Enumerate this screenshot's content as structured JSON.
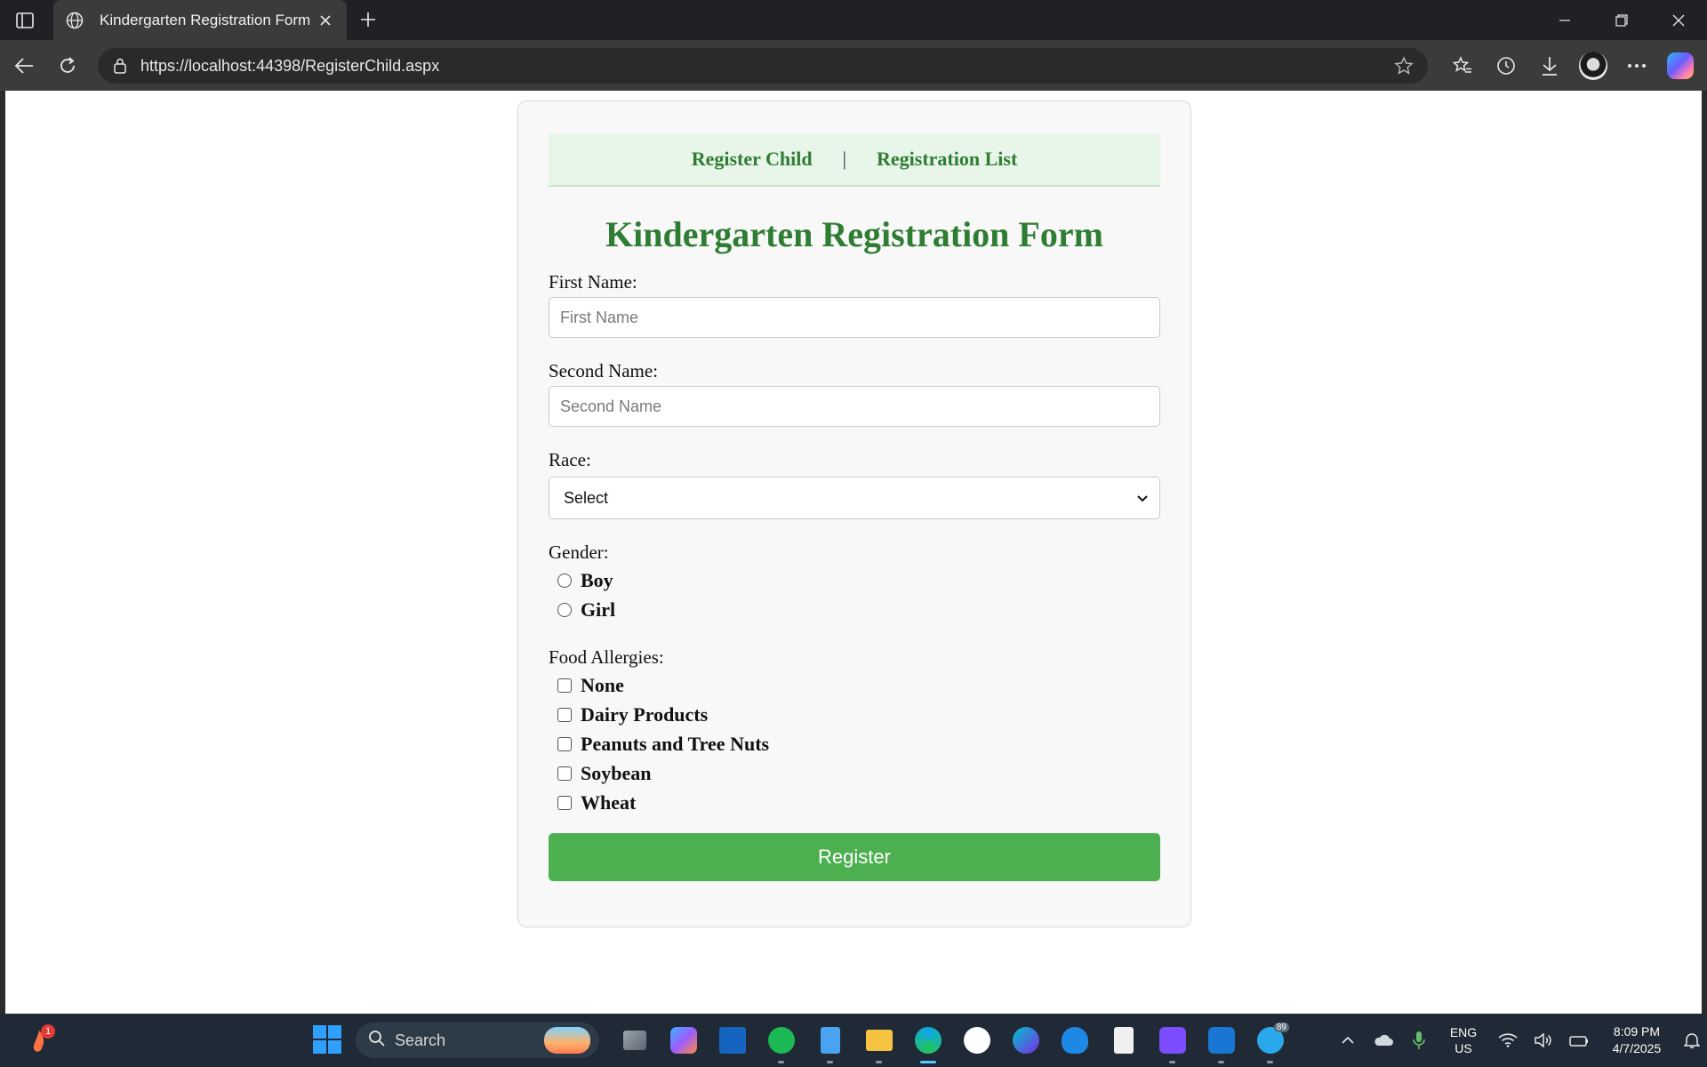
{
  "browser": {
    "tab_title": "Kindergarten Registration Form",
    "url": "https://localhost:44398/RegisterChild.aspx"
  },
  "page": {
    "nav": {
      "register_child": "Register Child",
      "separator": "|",
      "registration_list": "Registration List"
    },
    "title": "Kindergarten Registration Form",
    "first_name": {
      "label": "First Name:",
      "placeholder": "First Name",
      "value": ""
    },
    "second_name": {
      "label": "Second Name:",
      "placeholder": "Second Name",
      "value": ""
    },
    "race": {
      "label": "Race:",
      "selected": "Select"
    },
    "gender": {
      "label": "Gender:",
      "options": [
        "Boy",
        "Girl"
      ]
    },
    "allergies": {
      "label": "Food Allergies:",
      "options": [
        "None",
        "Dairy Products",
        "Peanuts and Tree Nuts",
        "Soybean",
        "Wheat"
      ]
    },
    "register_button": "Register"
  },
  "taskbar": {
    "notification_badge": "1",
    "search_text": "Search",
    "telegram_badge": "89",
    "language": {
      "line1": "ENG",
      "line2": "US"
    },
    "time": "8:09 PM",
    "date": "4/7/2025"
  },
  "colors": {
    "accent_green": "#2e7d32",
    "button_green": "#4caf50",
    "nav_bg": "#e8f5e9"
  }
}
